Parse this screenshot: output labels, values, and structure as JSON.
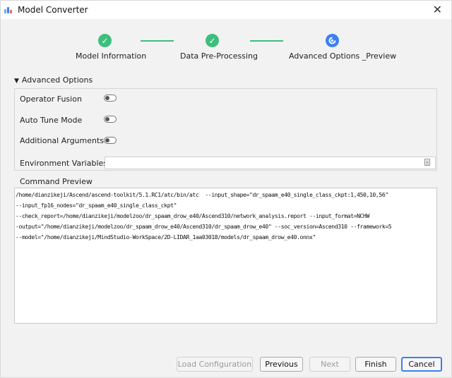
{
  "window": {
    "title": "Model Converter"
  },
  "steps": [
    {
      "label": "Model Information",
      "state": "done"
    },
    {
      "label": "Data Pre-Processing",
      "state": "done"
    },
    {
      "label": "Advanced Options _Preview",
      "state": "current"
    }
  ],
  "advanced": {
    "header": "Advanced Options",
    "options": [
      {
        "label": "Operator Fusion",
        "on": false
      },
      {
        "label": "Auto Tune Mode",
        "on": false
      },
      {
        "label": "Additional Arguments",
        "on": false
      }
    ],
    "env_label": "Environment Variables",
    "env_value": ""
  },
  "preview": {
    "label": "Command Preview",
    "lines": [
      "/home/dianzikeji/Ascend/ascend-toolkit/5.1.RC1/atc/bin/atc  --input_shape=\"dr_spaam_e40_single_class_ckpt:1,450,10,56\"",
      "--input_fp16_nodes=\"dr_spaam_e40_single_class_ckpt\"",
      "--check_report=/home/dianzikeji/modelzoo/dr_spaam_drow_e40/Ascend310/network_analysis.report --input_format=NCHW",
      "-output=\"/home/dianzikeji/modelzoo/dr_spaam_drow_e40/Ascend310/dr_spaam_drow_e40\" --soc_version=Ascend310 --framework=5",
      "--model=\"/home/dianzikeji/MindStudio-WorkSpace/2D-LIDAR_1aa03018/models/dr_spaam_drow_e40.onnx\""
    ]
  },
  "buttons": {
    "load": "Load Configuration",
    "previous": "Previous",
    "next": "Next",
    "finish": "Finish",
    "cancel": "Cancel"
  },
  "colors": {
    "done": "#3cbf7c",
    "current": "#3c7ff0"
  },
  "icons": {
    "close": "close-icon",
    "check": "check-icon",
    "progress": "progress-icon",
    "collapse": "triangle-down-icon",
    "env": "document-icon"
  }
}
